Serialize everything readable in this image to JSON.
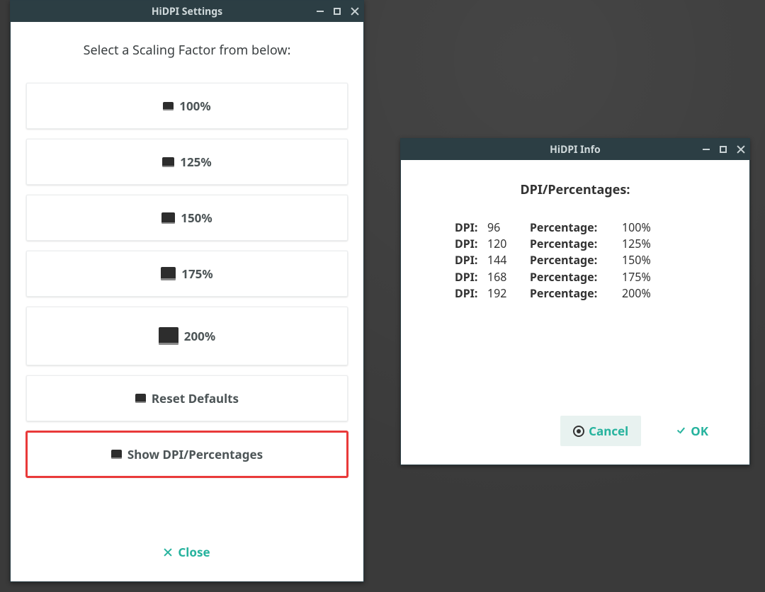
{
  "settings": {
    "title": "HiDPI Settings",
    "prompt": "Select a Scaling Factor from below:",
    "options": [
      {
        "label": "100%"
      },
      {
        "label": "125%"
      },
      {
        "label": "150%"
      },
      {
        "label": "175%"
      },
      {
        "label": "200%"
      }
    ],
    "reset_label": "Reset Defaults",
    "show_dpi_label": "Show DPI/Percentages",
    "close_label": "Close"
  },
  "info": {
    "title": "HiDPI Info",
    "heading": "DPI/Percentages:",
    "dpi_label": "DPI:",
    "pct_label": "Percentage:",
    "rows": [
      {
        "dpi": "96",
        "pct": "100%"
      },
      {
        "dpi": "120",
        "pct": "125%"
      },
      {
        "dpi": "144",
        "pct": "150%"
      },
      {
        "dpi": "168",
        "pct": "175%"
      },
      {
        "dpi": "192",
        "pct": "200%"
      }
    ],
    "cancel_label": "Cancel",
    "ok_label": "OK"
  }
}
